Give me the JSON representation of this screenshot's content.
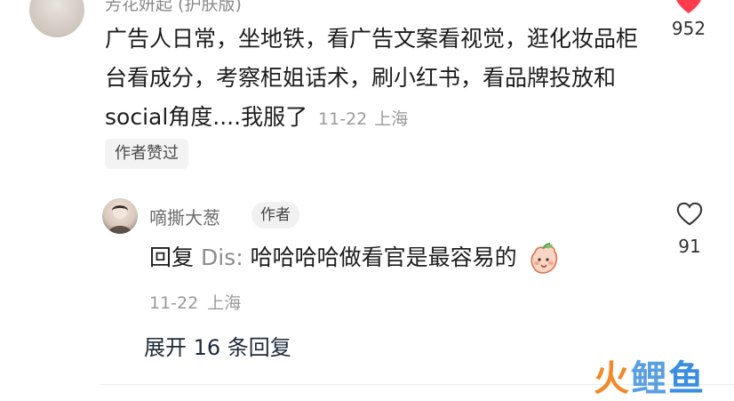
{
  "top_comment": {
    "username": "芳花妍起 (护肤版)",
    "text": "广告人日常，坐地铁，看广告文案看视觉，逛化妆品柜台看成分，考察柜姐话术，刷小红书，看品牌投放和social角度....我服了",
    "date": "11-22",
    "location": "上海",
    "author_liked": "作者赞过",
    "like_count": "952",
    "like_icon": "heart-filled-icon",
    "like_color": "#ff3b4e"
  },
  "reply": {
    "username": "嘀撕大葱",
    "author_tag": "作者",
    "reply_prefix": "回复",
    "mention": "Dis:",
    "text": "哈哈哈哈做看官是最容易的",
    "emoji": "peach-face-emoji",
    "date": "11-22",
    "location": "上海",
    "like_count": "91",
    "like_icon": "heart-outline-icon"
  },
  "expand_replies": "展开 16 条回复",
  "watermark": {
    "part1": "火",
    "part2": "鲤",
    "part3": "鱼"
  }
}
